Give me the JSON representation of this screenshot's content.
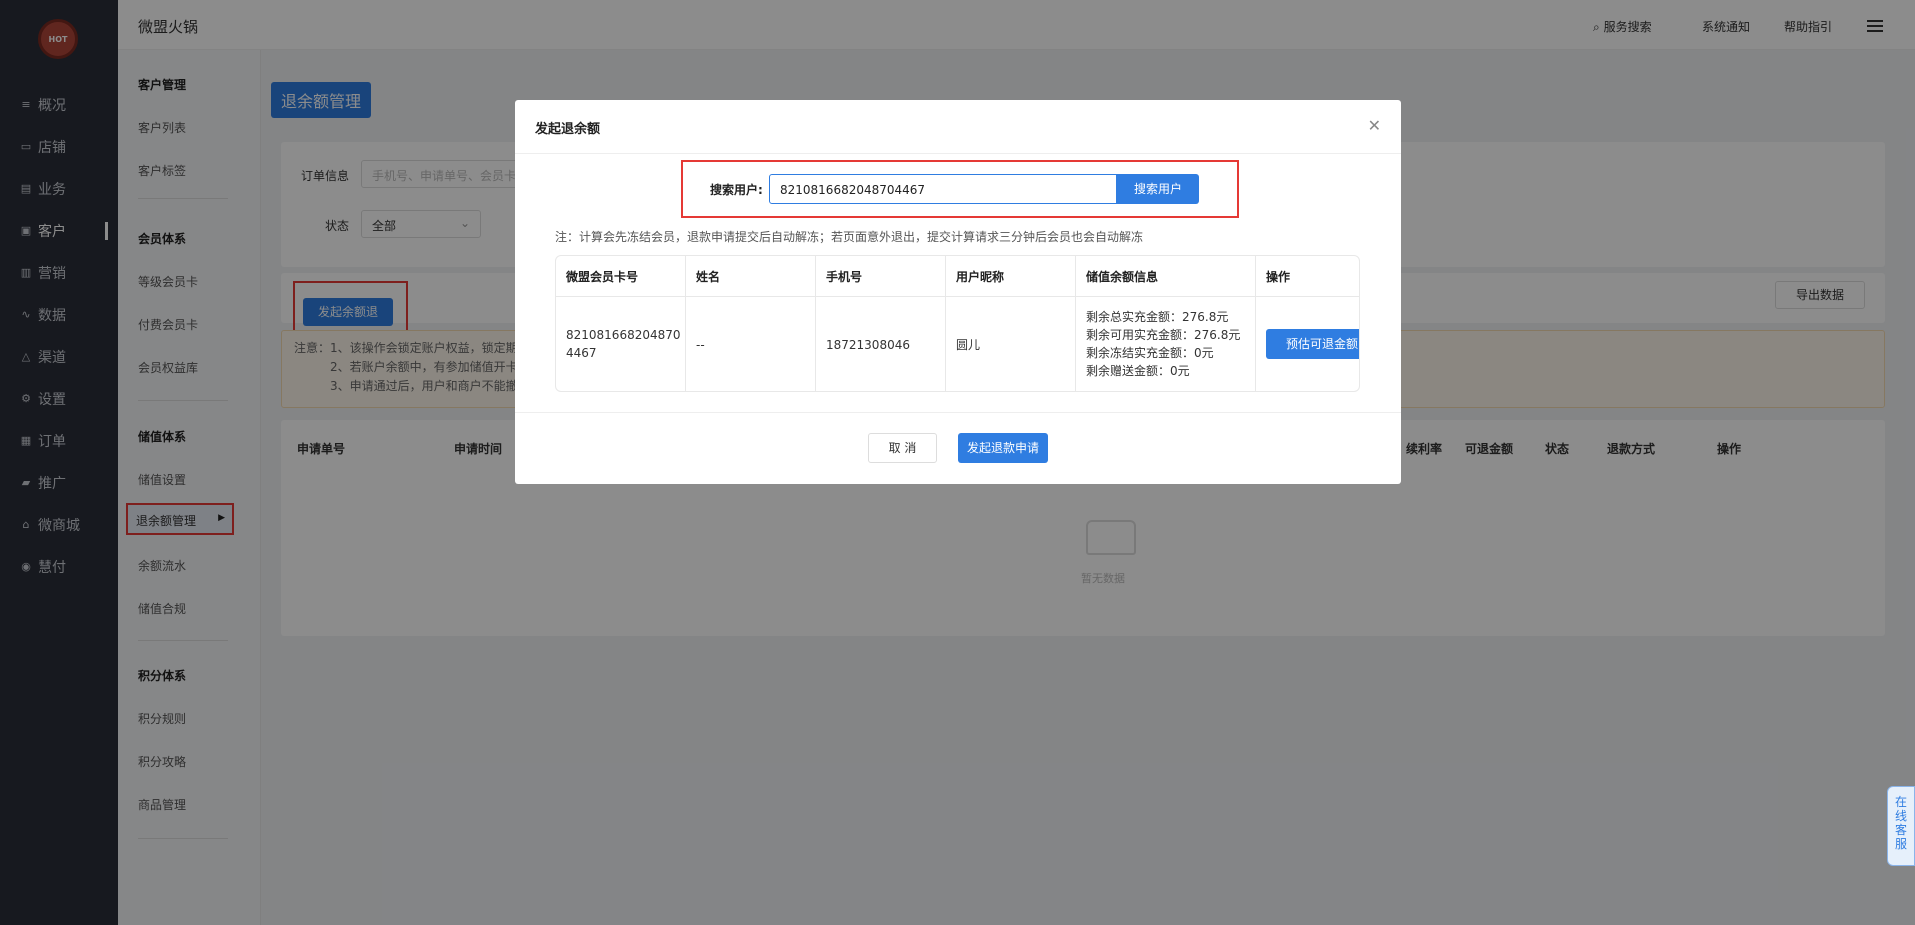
{
  "leftnav": {
    "logo_text": "HOT",
    "items": [
      {
        "label": "概况",
        "icon": "overview-icon"
      },
      {
        "label": "店铺",
        "icon": "store-icon"
      },
      {
        "label": "业务",
        "icon": "business-icon"
      },
      {
        "label": "客户",
        "icon": "customer-icon"
      },
      {
        "label": "营销",
        "icon": "marketing-icon"
      },
      {
        "label": "数据",
        "icon": "data-icon"
      },
      {
        "label": "渠道",
        "icon": "channel-icon"
      },
      {
        "label": "设置",
        "icon": "settings-icon"
      },
      {
        "label": "订单",
        "icon": "order-icon"
      },
      {
        "label": "推广",
        "icon": "promotion-icon"
      },
      {
        "label": "微商城",
        "icon": "mall-icon"
      },
      {
        "label": "慧付",
        "icon": "pay-icon"
      }
    ]
  },
  "subnav": {
    "brand": "微盟火锅",
    "groups": [
      {
        "title": "客户管理",
        "items": [
          "客户列表",
          "客户标签"
        ]
      },
      {
        "title": "会员体系",
        "items": [
          "等级会员卡",
          "付费会员卡",
          "会员权益库"
        ]
      },
      {
        "title": "储值体系",
        "items": [
          "储值设置",
          "退余额管理",
          "余额流水",
          "储值合规"
        ]
      },
      {
        "title": "积分体系",
        "items": [
          "积分规则",
          "积分攻略",
          "商品管理"
        ]
      }
    ]
  },
  "topbar": {
    "search": "服务搜索",
    "notice": "系统通知",
    "help": "帮助指引"
  },
  "main": {
    "title": "退余额管理",
    "filter": {
      "order_label": "订单信息",
      "order_placeholder": "手机号、申请单号、会员卡",
      "status_label": "状态",
      "status_value": "全部"
    },
    "initiate_button": "发起余额退",
    "export_button": "导出数据",
    "notice": {
      "line1": "注意：1、该操作会锁定账户权益，锁定期",
      "line2": "2、若账户余额中，有参加储值开卡",
      "line3": "3、申请通过后，用户和商户不能撤"
    },
    "table_headers": [
      "申请单号",
      "申请时间",
      "续利率",
      "可退金额",
      "状态",
      "退款方式",
      "操作"
    ],
    "empty_text": "暂无数据"
  },
  "modal": {
    "title": "发起退余额",
    "search_label": "搜索用户:",
    "search_value": "8210816682048704467",
    "search_button": "搜索用户",
    "note": "注：计算会先冻结会员，退款申请提交后自动解冻；若页面意外退出，提交计算请求三分钟后会员也会自动解冻",
    "table": {
      "headers": [
        "微盟会员卡号",
        "姓名",
        "手机号",
        "用户昵称",
        "储值余额信息",
        "操作"
      ],
      "row": {
        "card_no_line1": "821081668204870",
        "card_no_line2": "4467",
        "name": "--",
        "phone": "18721308046",
        "nickname": "圆儿",
        "balance": [
          "剩余总实充金额：276.8元",
          "剩余可用实充金额：276.8元",
          "剩余冻结实充金额：0元",
          "剩余赠送金额：0元"
        ],
        "action": "预估可退金额"
      }
    },
    "cancel": "取 消",
    "submit": "发起退款申请"
  },
  "service": "在线客服"
}
